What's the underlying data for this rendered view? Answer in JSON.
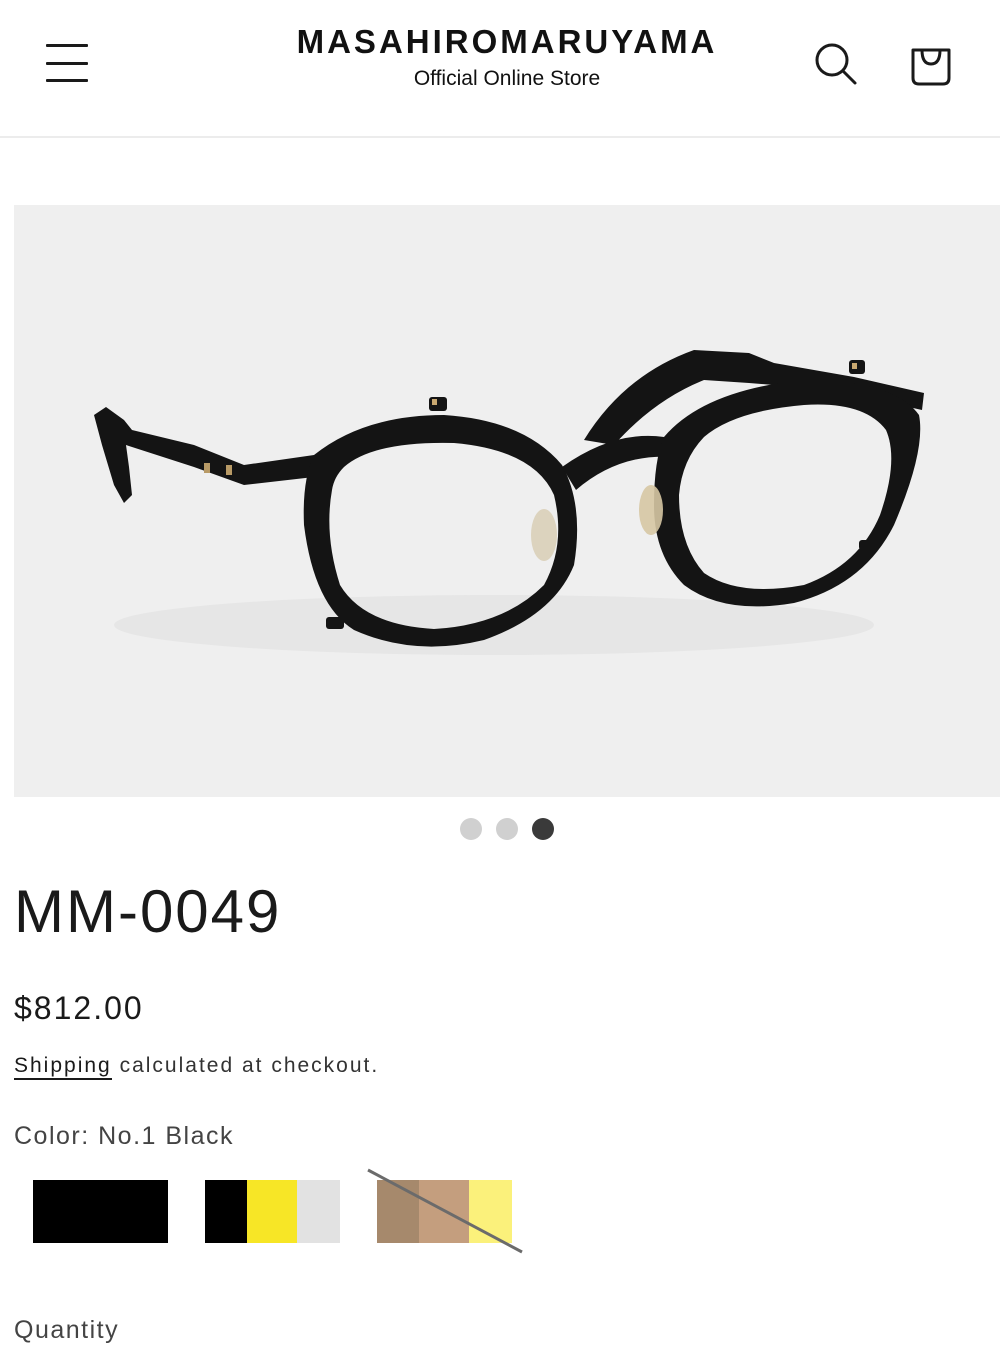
{
  "header": {
    "brand": "MASAHIROMARUYAMA",
    "subtitle": "Official Online Store",
    "menu_icon": "hamburger-menu-icon",
    "search_icon": "search-icon",
    "cart_icon": "shopping-bag-icon"
  },
  "gallery": {
    "image_alt": "MM-0049 eyeglasses",
    "slide_count": 3,
    "active_slide": 3
  },
  "product": {
    "title": "MM-0049",
    "price": "$812.00",
    "shipping_link": "Shipping",
    "shipping_rest": " calculated at checkout.",
    "color_label": "Color: No.1 Black",
    "quantity_label": "Quantity"
  },
  "swatches": [
    {
      "name": "No.1 Black",
      "colors": [
        "#000000"
      ],
      "selected": true,
      "available": true
    },
    {
      "name": "Black Yellow Gray",
      "colors": [
        "#000000",
        "#f7e626",
        "#e2e2e2"
      ],
      "selected": false,
      "available": true
    },
    {
      "name": "Brown Beige Yellow",
      "colors": [
        "#a6896c",
        "#c49e7e",
        "#fbf17b"
      ],
      "selected": false,
      "available": false
    }
  ],
  "colors": {
    "text": "#1a1a1a",
    "gallery_bg": "#efefef",
    "dot_inactive": "#d0d0d0",
    "dot_active": "#3a3a3a"
  }
}
